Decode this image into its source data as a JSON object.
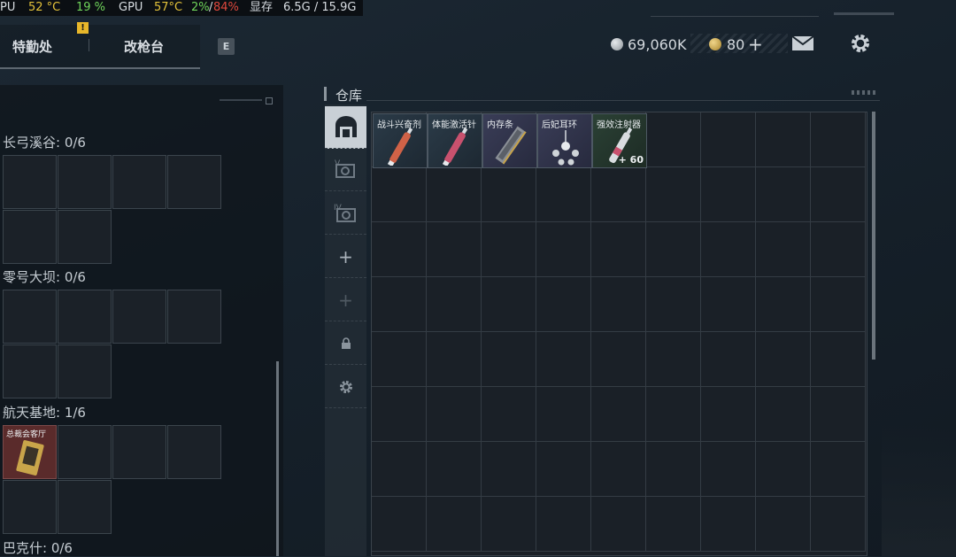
{
  "hud": {
    "cpu_label": "PU",
    "cpu_temp": "52 °C",
    "cpu_usage": "19 %",
    "gpu_label": "GPU",
    "gpu_temp": "57°C",
    "gpu_usage_a": "2%",
    "gpu_sep": "/",
    "gpu_usage_b": "84%",
    "vram_label": "显存",
    "vram_value": "6.5G / 15.9G"
  },
  "nav": {
    "tab1": "特勤处",
    "tab2": "改枪台",
    "alert": "!",
    "key_hint": "E"
  },
  "currency": {
    "silver": "69,060K",
    "gold": "80",
    "add": "+"
  },
  "colors": {
    "accent_yellow": "#e8b72a",
    "temp_yellow": "#e3c23a",
    "usage_green": "#6fd35a",
    "usage_red": "#e0483d"
  },
  "rooms": [
    {
      "label": "长弓溪谷: 0/6"
    },
    {
      "label": "零号大坝: 0/6"
    },
    {
      "label": "航天基地: 1/6",
      "item_label": "总裁会客厅"
    },
    {
      "label": "巴克什: 0/6"
    }
  ],
  "warehouse": {
    "title": "仓库",
    "sidebar_icons": [
      "storage-icon",
      "case-v-icon",
      "case-iv-icon",
      "plus-icon",
      "plus-disabled-icon",
      "lock-icon",
      "gear-icon"
    ],
    "sidebar_texts": {
      "v": "V",
      "iv": "IV",
      "plus": "+"
    },
    "items": [
      {
        "name": "战斗兴奋剂",
        "qty": ""
      },
      {
        "name": "体能激活针",
        "qty": ""
      },
      {
        "name": "内存条",
        "qty": ""
      },
      {
        "name": "后妃耳环",
        "qty": ""
      },
      {
        "name": "强效注射器",
        "qty": "+ 60"
      }
    ]
  }
}
